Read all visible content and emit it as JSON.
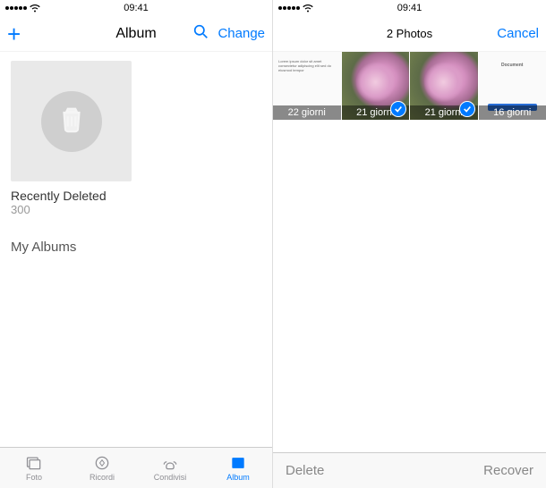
{
  "status": {
    "time": "09:41"
  },
  "left": {
    "nav": {
      "title": "Album",
      "change": "Change"
    },
    "album": {
      "name": "Recently Deleted",
      "count": "300"
    },
    "section": "My Albums",
    "tabs": {
      "foto": "Foto",
      "ricordi": "Ricordi",
      "condivisi": "Condivisi",
      "album": "Album"
    }
  },
  "right": {
    "nav": {
      "title": "2 Photos",
      "cancel": "Cancel"
    },
    "thumbs": {
      "t0": "22 giorni",
      "t1": "21 giorni",
      "t2": "21 giorni",
      "t3": "16 giorni"
    },
    "toolbar": {
      "delete": "Delete",
      "recover": "Recover"
    }
  }
}
